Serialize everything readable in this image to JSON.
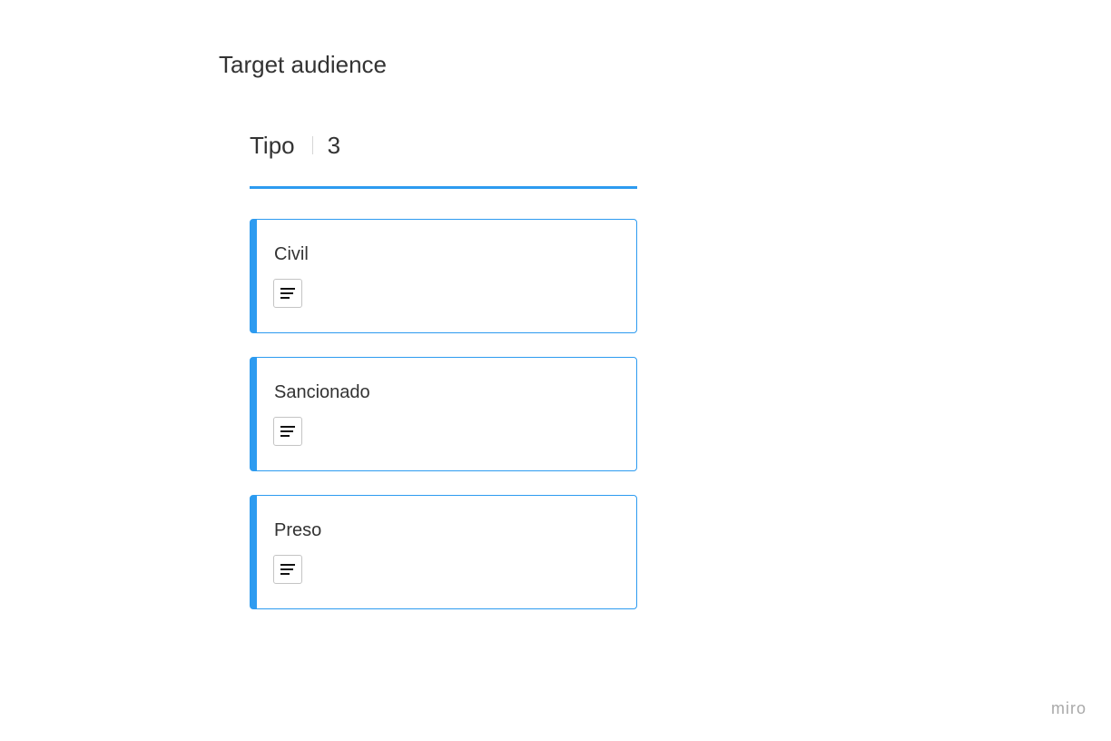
{
  "frame": {
    "title": "Target audience"
  },
  "column": {
    "name": "Tipo",
    "count": "3",
    "accent_color": "#2d9bf0",
    "cards": [
      {
        "title": "Civil",
        "icon": "description-lines-icon"
      },
      {
        "title": "Sancionado",
        "icon": "description-lines-icon"
      },
      {
        "title": "Preso",
        "icon": "description-lines-icon"
      }
    ]
  },
  "watermark": "miro"
}
